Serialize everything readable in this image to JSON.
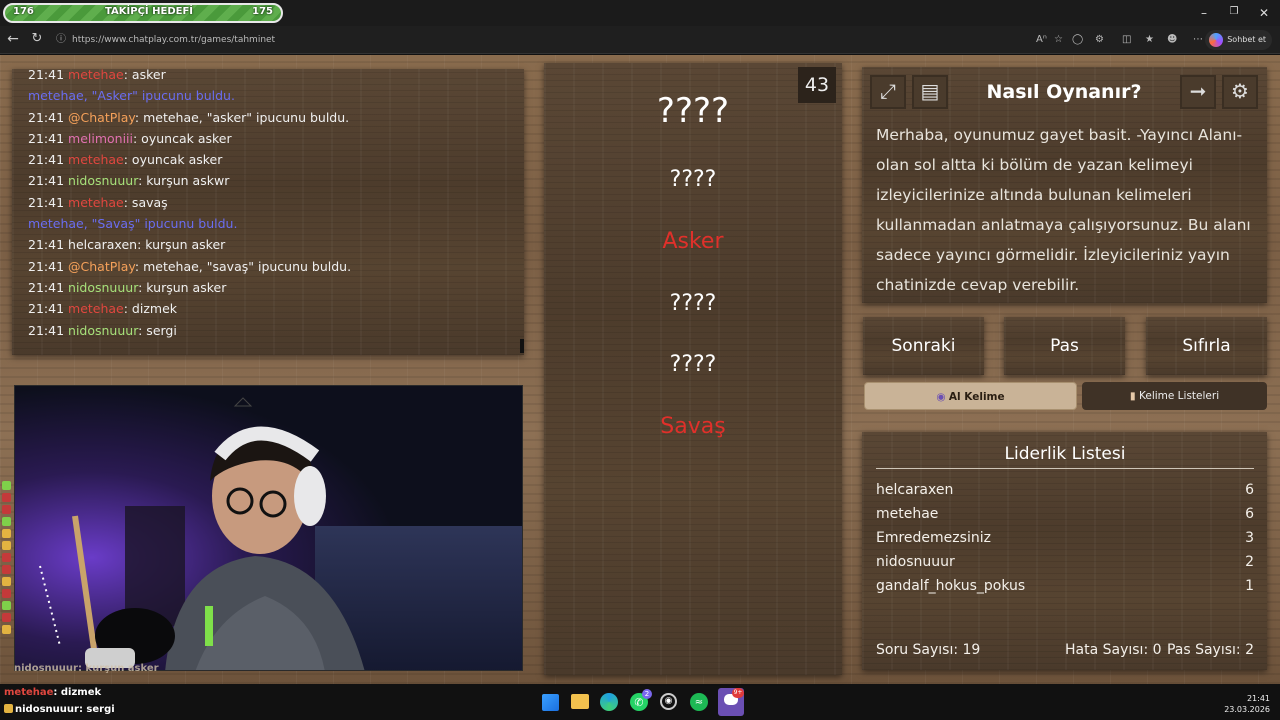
{
  "goal": {
    "current": "176",
    "title": "TAKİPÇİ HEDEFİ",
    "target": "175"
  },
  "browser": {
    "url": "https://www.chatplay.com.tr/games/tahminet",
    "chat_button": "Sohbet et"
  },
  "chat": {
    "messages": [
      {
        "time": "21:41",
        "user": "metehae",
        "user_color": "red",
        "text": ": asker",
        "system": false
      },
      {
        "time": "",
        "user": "",
        "user_color": "",
        "text": "metehae, \"Asker\" ipucunu buldu.",
        "system": true
      },
      {
        "time": "21:41",
        "user": "@ChatPlay",
        "user_color": "orange",
        "text": ": metehae, \"asker\" ipucunu buldu.",
        "system": false
      },
      {
        "time": "21:41",
        "user": "melimoniii",
        "user_color": "pink",
        "text": ": oyuncak asker",
        "system": false
      },
      {
        "time": "21:41",
        "user": "metehae",
        "user_color": "red",
        "text": ": oyuncak asker",
        "system": false
      },
      {
        "time": "21:41",
        "user": "nidosnuuur",
        "user_color": "green",
        "text": ": kurşun askwr",
        "system": false
      },
      {
        "time": "21:41",
        "user": "metehae",
        "user_color": "red",
        "text": ": savaş",
        "system": false
      },
      {
        "time": "",
        "user": "",
        "user_color": "",
        "text": "metehae, \"Savaş\" ipucunu buldu.",
        "system": true
      },
      {
        "time": "21:41",
        "user": "helcaraxen",
        "user_color": "white",
        "text": ": kurşun asker",
        "system": false
      },
      {
        "time": "21:41",
        "user": "@ChatPlay",
        "user_color": "orange",
        "text": ": metehae, \"savaş\" ipucunu buldu.",
        "system": false
      },
      {
        "time": "21:41",
        "user": "nidosnuuur",
        "user_color": "green",
        "text": ": kurşun asker",
        "system": false
      },
      {
        "time": "21:41",
        "user": "metehae",
        "user_color": "red",
        "text": ": dizmek",
        "system": false
      },
      {
        "time": "21:41",
        "user": "nidosnuuur",
        "user_color": "green",
        "text": ": sergi",
        "system": false
      }
    ]
  },
  "overlay_chat": {
    "line1_user": "nidosnuuur",
    "line1_text": ": kurşun asker",
    "line2_user": "metehae",
    "line2_text": ": dizmek",
    "line3_user": "nidosnuuur",
    "line3_text": ": sergi"
  },
  "game": {
    "timer": "43",
    "main_word": "????",
    "clues": [
      "????",
      "Asker",
      "????",
      "????",
      "Savaş"
    ],
    "found": [
      false,
      true,
      false,
      false,
      true
    ]
  },
  "howto": {
    "title": "Nasıl Oynanır?",
    "text": "Merhaba, oyunumuz gayet basit. -Yayıncı Alanı- olan sol altta ki bölüm de yazan kelimeyi izleyicilerinize altında bulunan kelimeleri kullanmadan anlatmaya çalışıyorsunuz. Bu alanı sadece yayıncı görmelidir. İzleyicileriniz yayın chatinizde cevap verebilir.",
    "icons": [
      "fullscreen-icon",
      "notes-icon",
      "exit-icon",
      "settings-icon"
    ]
  },
  "controls": {
    "next": "Sonraki",
    "pass": "Pas",
    "reset": "Sıfırla",
    "al_kelime": "Al Kelime",
    "word_lists": "Kelime Listeleri"
  },
  "leaderboard": {
    "title": "Liderlik Listesi",
    "rows": [
      {
        "name": "helcaraxen",
        "score": "6"
      },
      {
        "name": "metehae",
        "score": "6"
      },
      {
        "name": "Emredemezsiniz",
        "score": "3"
      },
      {
        "name": "nidosnuuur",
        "score": "2"
      },
      {
        "name": "gandalf_hokus_pokus",
        "score": "1"
      }
    ],
    "stats": {
      "questions": "Soru Sayısı: 19",
      "errors": "Hata Sayısı: 0",
      "passes": "Pas Sayısı: 2"
    }
  },
  "taskbar": {
    "time": "21:41",
    "date": "23.03.2026",
    "whatsapp_badge": "2",
    "discord_badge": "9+"
  }
}
